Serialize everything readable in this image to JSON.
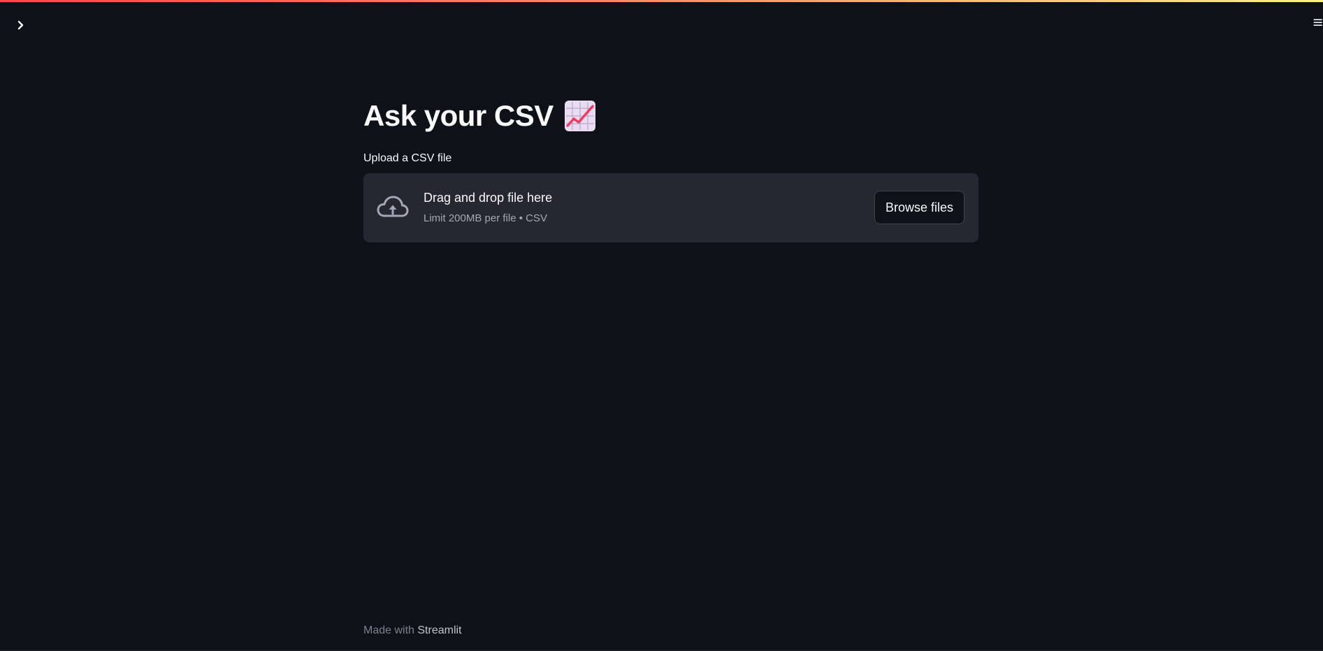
{
  "header": {
    "sidebar_toggle_icon": "chevron-right-icon",
    "menu_icon": "hamburger-menu-icon",
    "decoration_gradient": [
      "#ff4b4b",
      "#fff27e"
    ]
  },
  "main": {
    "title": "Ask your CSV",
    "title_emoji_icon": "chart-increasing-icon",
    "uploader": {
      "label": "Upload a CSV file",
      "drop_title": "Drag and drop file here",
      "drop_subtitle": "Limit 200MB per file • CSV",
      "browse_label": "Browse files",
      "icon": "cloud-upload-icon"
    }
  },
  "footer": {
    "prefix": "Made with",
    "link_text": "Streamlit"
  },
  "colors": {
    "background": "#0e1117",
    "dropzone": "#262730",
    "text": "#fafafa",
    "muted": "#a3a8b8"
  }
}
